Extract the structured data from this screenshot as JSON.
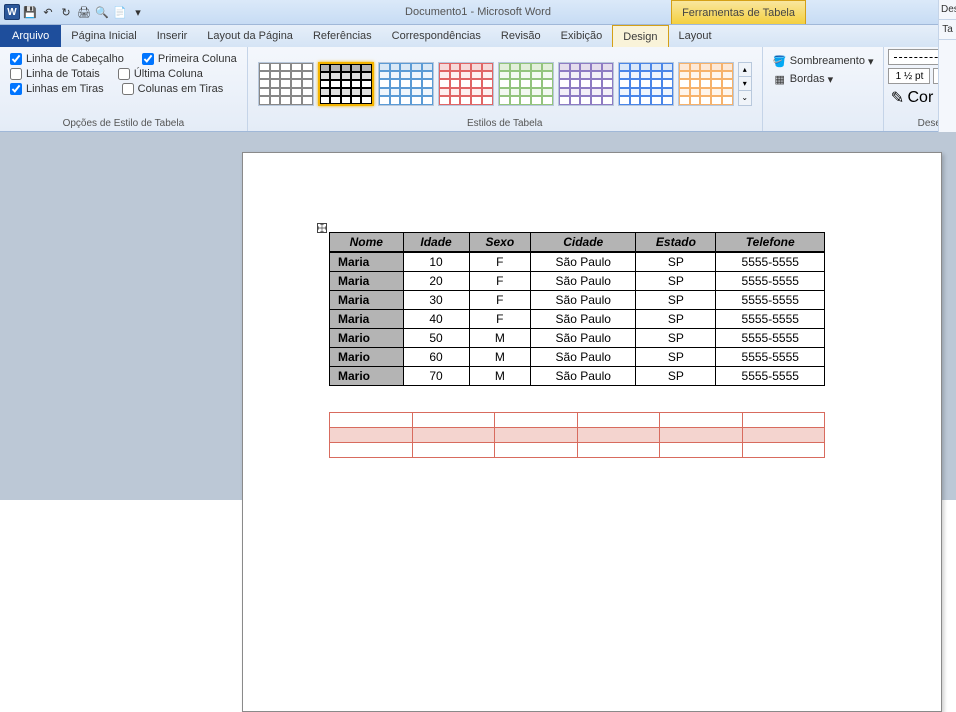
{
  "title": "Documento1 - Microsoft Word",
  "context_tab": "Ferramentas de Tabela",
  "file_tab": "Arquivo",
  "tabs": [
    "Página Inicial",
    "Inserir",
    "Layout da Página",
    "Referências",
    "Correspondências",
    "Revisão",
    "Exibição",
    "Design",
    "Layout"
  ],
  "active_tab": "Design",
  "style_options": {
    "header_row": {
      "label": "Linha de Cabeçalho",
      "checked": true
    },
    "total_row": {
      "label": "Linha de Totais",
      "checked": false
    },
    "banded_rows": {
      "label": "Linhas em Tiras",
      "checked": true
    },
    "first_col": {
      "label": "Primeira Coluna",
      "checked": true
    },
    "last_col": {
      "label": "Última Coluna",
      "checked": false
    },
    "banded_cols": {
      "label": "Colunas em Tiras",
      "checked": false
    }
  },
  "group_labels": {
    "style_opts": "Opções de Estilo de Tabela",
    "styles": "Estilos de Tabela",
    "draw": "Desenhar Bordas"
  },
  "ribbon_btns": {
    "shading": "Sombreamento",
    "borders": "Bordas",
    "pen_color": "Cor da Caneta"
  },
  "weight": "1 ½ pt",
  "right_strip": {
    "dese": "Des",
    "ta": "Ta"
  },
  "style_thumbs": [
    {
      "border": "#888",
      "header": "#fff",
      "alt": "#fff"
    },
    {
      "border": "#000",
      "header": "#b4b4b4",
      "alt": "#e0e0e0"
    },
    {
      "border": "#5b9bd5",
      "header": "#d9e8f6",
      "alt": "#f0f6fc"
    },
    {
      "border": "#e06666",
      "header": "#f6d9d9",
      "alt": "#fdf0f0"
    },
    {
      "border": "#93c47d",
      "header": "#e2efda",
      "alt": "#f3f9f1"
    },
    {
      "border": "#8e7cc3",
      "header": "#e4dded",
      "alt": "#f3f0f8"
    },
    {
      "border": "#4a86e8",
      "header": "#dbe8f9",
      "alt": "#eff5fd"
    },
    {
      "border": "#f6b26b",
      "header": "#fde8d6",
      "alt": "#fef5ec"
    }
  ],
  "table": {
    "headers": [
      "Nome",
      "Idade",
      "Sexo",
      "Cidade",
      "Estado",
      "Telefone"
    ],
    "rows": [
      {
        "nome": "Maria",
        "idade": "10",
        "sexo": "F",
        "cidade": "São Paulo",
        "estado": "SP",
        "telefone": "5555-5555"
      },
      {
        "nome": "Maria",
        "idade": "20",
        "sexo": "F",
        "cidade": "São Paulo",
        "estado": "SP",
        "telefone": "5555-5555"
      },
      {
        "nome": "Maria",
        "idade": "30",
        "sexo": "F",
        "cidade": "São Paulo",
        "estado": "SP",
        "telefone": "5555-5555"
      },
      {
        "nome": "Maria",
        "idade": "40",
        "sexo": "F",
        "cidade": "São Paulo",
        "estado": "SP",
        "telefone": "5555-5555"
      },
      {
        "nome": "Mario",
        "idade": "50",
        "sexo": "M",
        "cidade": "São Paulo",
        "estado": "SP",
        "telefone": "5555-5555"
      },
      {
        "nome": "Mario",
        "idade": "60",
        "sexo": "M",
        "cidade": "São Paulo",
        "estado": "SP",
        "telefone": "5555-5555"
      },
      {
        "nome": "Mario",
        "idade": "70",
        "sexo": "M",
        "cidade": "São Paulo",
        "estado": "SP",
        "telefone": "5555-5555"
      }
    ]
  },
  "empty_table": {
    "rows": 3,
    "cols": 6
  }
}
